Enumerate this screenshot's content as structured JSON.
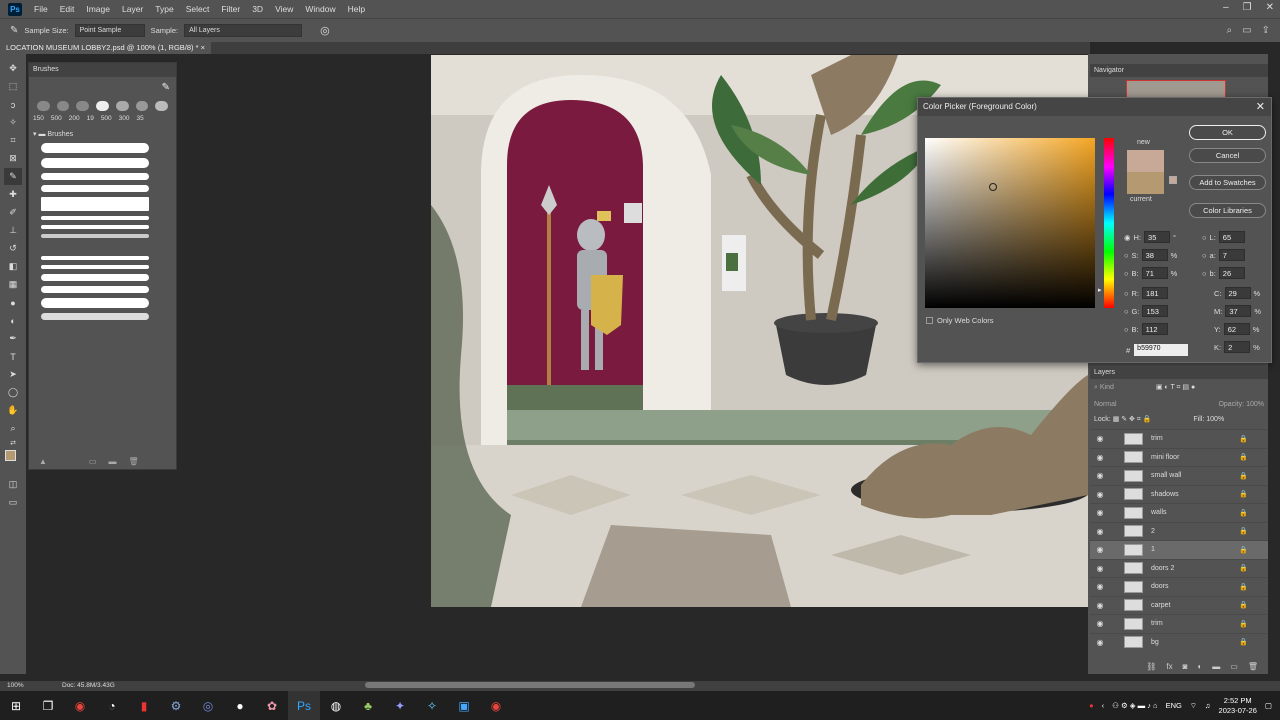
{
  "menubar": {
    "app_icon": "Ps",
    "items": [
      "File",
      "Edit",
      "Image",
      "Layer",
      "Type",
      "Select",
      "Filter",
      "3D",
      "View",
      "Window",
      "Help"
    ]
  },
  "options": {
    "sample_size_label": "Sample Size:",
    "sample_size_value": "Point Sample",
    "sample_label": "Sample:",
    "sample_value": "All Layers"
  },
  "document": {
    "tab_title": "LOCATION MUSEUM LOBBY2.psd @ 100% (1, RGB/8) *"
  },
  "brushes_panel": {
    "title": "Brushes",
    "sizes": [
      "150",
      "500",
      "200",
      "19",
      "500",
      "300",
      "35"
    ],
    "folder": "Brushes"
  },
  "navigator": {
    "title": "Navigator"
  },
  "color_picker": {
    "title": "Color Picker (Foreground Color)",
    "new_label": "new",
    "current_label": "current",
    "new_color": "#c8a896",
    "current_color": "#b59970",
    "ok": "OK",
    "cancel": "Cancel",
    "add_to_swatches": "Add to Swatches",
    "color_libraries": "Color Libraries",
    "only_web_colors": "Only Web Colors",
    "fields": {
      "H": "35",
      "S": "38",
      "B": "71",
      "R": "181",
      "G": "153",
      "B2": "112",
      "L": "65",
      "a": "7",
      "b": "26",
      "C": "29",
      "M": "37",
      "Y": "62",
      "K": "2"
    },
    "hex": "b59970"
  },
  "layers_panel": {
    "title": "Layers",
    "filter_placeholder": "Kind",
    "blend_mode": "Normal",
    "opacity_label": "Opacity:",
    "opacity_value": "100%",
    "lock_label": "Lock:",
    "fill_label": "Fill:",
    "fill_value": "100%",
    "layers": [
      {
        "name": "trim"
      },
      {
        "name": "mini floor"
      },
      {
        "name": "small wall"
      },
      {
        "name": "shadows"
      },
      {
        "name": "walls"
      },
      {
        "name": "2"
      },
      {
        "name": "1"
      },
      {
        "name": "doors 2"
      },
      {
        "name": "doors"
      },
      {
        "name": "carpet"
      },
      {
        "name": "trim"
      },
      {
        "name": "bg"
      }
    ]
  },
  "status": {
    "zoom": "100%",
    "doc": "Doc: 45.8M/3.43G"
  },
  "taskbar": {
    "lang": "ENG",
    "time": "2:52 PM",
    "date": "2023-07-26"
  }
}
